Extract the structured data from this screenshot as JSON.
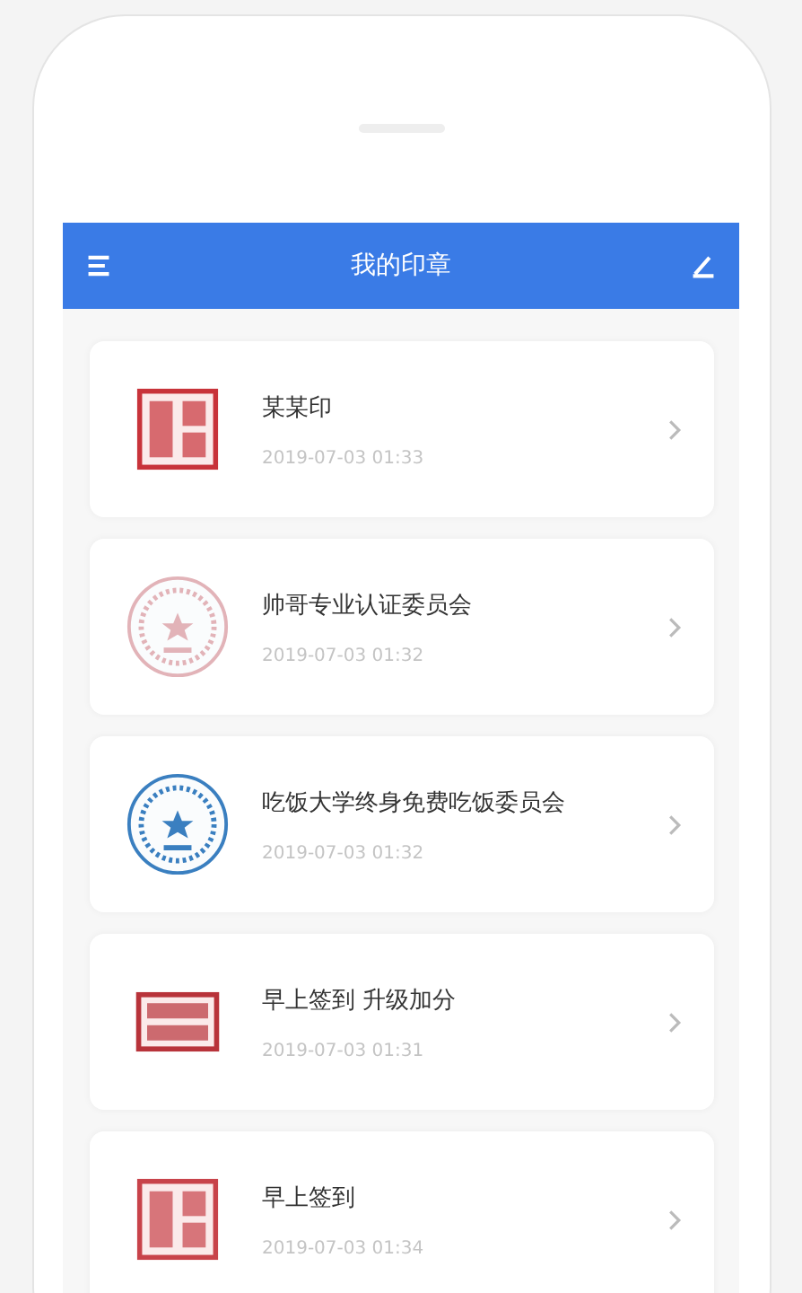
{
  "header": {
    "title": "我的印章"
  },
  "seals": [
    {
      "name": "某某印",
      "time": "2019-07-03 01:33",
      "seal": {
        "kind": "square",
        "color": "#c8333a"
      }
    },
    {
      "name": "帅哥专业认证委员会",
      "time": "2019-07-03 01:32",
      "seal": {
        "kind": "round",
        "color": "#e2b3b8"
      }
    },
    {
      "name": "吃饭大学终身免费吃饭委员会",
      "time": "2019-07-03 01:32",
      "seal": {
        "kind": "round",
        "color": "#3a7fc0"
      }
    },
    {
      "name": "早上签到 升级加分",
      "time": "2019-07-03 01:31",
      "seal": {
        "kind": "wide",
        "color": "#b8333a"
      }
    },
    {
      "name": "早上签到",
      "time": "2019-07-03 01:34",
      "seal": {
        "kind": "square",
        "color": "#c8434a"
      }
    }
  ]
}
